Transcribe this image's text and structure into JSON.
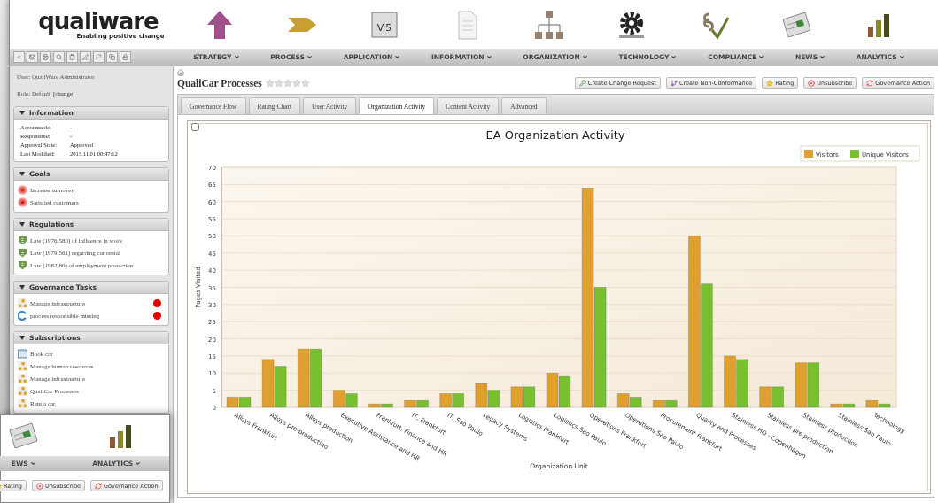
{
  "logo": {
    "name": "qualiware",
    "tagline": "Enabling positive change"
  },
  "nav": [
    {
      "label": "STRATEGY",
      "kind": "up-arrow"
    },
    {
      "label": "PROCESS",
      "kind": "chevron"
    },
    {
      "label": "APPLICATION",
      "kind": "version-box",
      "badge": "V.5"
    },
    {
      "label": "INFORMATION",
      "kind": "document"
    },
    {
      "label": "ORGANIZATION",
      "kind": "org-chart"
    },
    {
      "label": "TECHNOLOGY",
      "kind": "gear"
    },
    {
      "label": "COMPLIANCE",
      "kind": "paragraph"
    },
    {
      "label": "NEWS",
      "kind": "newspaper"
    },
    {
      "label": "ANALYTICS",
      "kind": "bar-chart"
    }
  ],
  "user": {
    "user_line": "User: QualiWare Administrator",
    "role_line": "Role: Default",
    "change_link": "[change]"
  },
  "panels": [
    {
      "title": "Information",
      "expanded": true,
      "kind": "fields",
      "fields": [
        {
          "label": "Accountable:",
          "value": "-"
        },
        {
          "label": "Responsible:",
          "value": "-"
        },
        {
          "label": "Approval State:",
          "value": "Approved"
        },
        {
          "label": "Last Modified:",
          "value": "2013.11.01 00:47:12"
        }
      ]
    },
    {
      "title": "Goals",
      "expanded": true,
      "kind": "items",
      "items": [
        {
          "kind": "target",
          "text": "Increase turnover"
        },
        {
          "kind": "target",
          "text": "Satisfied customers"
        }
      ]
    },
    {
      "title": "Regulations",
      "expanded": true,
      "kind": "items",
      "items": [
        {
          "kind": "shield",
          "text": "Law (1976:580) of influence in work"
        },
        {
          "kind": "shield",
          "text": "Law (1979:561) regarding car rental"
        },
        {
          "kind": "shield",
          "text": "Law (1982:80) of employment protection"
        }
      ]
    },
    {
      "title": "Governance Tasks",
      "expanded": true,
      "kind": "items",
      "items": [
        {
          "kind": "process",
          "text": "Manage infrastructure",
          "color": "#e00000"
        },
        {
          "kind": "cycle",
          "text": "process responsible missing",
          "color": "#e00000"
        }
      ]
    },
    {
      "title": "Subscriptions",
      "expanded": true,
      "kind": "items",
      "items": [
        {
          "kind": "calendar",
          "text": "Book car"
        },
        {
          "kind": "process",
          "text": "Manage human resources"
        },
        {
          "kind": "process",
          "text": "Manage infrastructure"
        },
        {
          "kind": "process",
          "text": "QualiCar Processes"
        },
        {
          "kind": "process",
          "text": "Rent a car"
        }
      ]
    }
  ],
  "page": {
    "title": "QualiCar Processes",
    "stars": 0
  },
  "actions": [
    {
      "label": "Create Change Request",
      "kind": "wrench"
    },
    {
      "label": "Create Non-Conformance",
      "kind": "branch"
    },
    {
      "label": "Rating",
      "kind": "star"
    },
    {
      "label": "Unsubscribe",
      "kind": "unsubscribe"
    },
    {
      "label": "Governance Action",
      "kind": "cycle"
    }
  ],
  "tabs": [
    {
      "label": "Governance Flow",
      "selected": false
    },
    {
      "label": "Rating Chart",
      "selected": false
    },
    {
      "label": "User Activity",
      "selected": false
    },
    {
      "label": "Organization Activity",
      "selected": true
    },
    {
      "label": "Content Activity",
      "selected": false
    },
    {
      "label": "Advanced",
      "selected": false
    }
  ],
  "chart_panel": {
    "checked": false,
    "chart_data": {
      "type": "bar",
      "title": "EA Organization Activity",
      "xlabel": "Organization Unit",
      "ylabel": "Pages Visited",
      "grid": true,
      "legend": true,
      "categories": [
        "Alloys Frankfurt",
        "Alloys pre-productino",
        "Alloys production",
        "Executive Assistance and HR",
        "Frankfurt, Finance and HR",
        "IT, Frankfurt",
        "IT, Sao Paulo",
        "Legacy Systems",
        "Logistics Frankfurt",
        "Logistics Sao Paulo",
        "Operations Frankfurt",
        "Operations Sao Paulo",
        "Procurement Frankfurt",
        "Quality and Processes",
        "Stainless HQ - Copenhagen",
        "Stainless pre production",
        "Stainless production",
        "Stainless Sao Paulo",
        "Technology"
      ],
      "series": [
        {
          "name": "Visitors",
          "color": "#e0a030",
          "values": [
            3,
            14,
            17,
            5,
            1,
            2,
            4,
            7,
            6,
            10,
            64,
            4,
            2,
            50,
            15,
            6,
            13,
            1,
            2
          ]
        },
        {
          "name": "Unique Visitors",
          "color": "#78c030",
          "values": [
            3,
            12,
            17,
            4,
            1,
            2,
            4,
            5,
            6,
            9,
            35,
            3,
            2,
            36,
            14,
            6,
            13,
            1,
            1
          ]
        }
      ],
      "ylim": [
        0,
        70
      ],
      "yticks": [
        0,
        5,
        10,
        15,
        20,
        25,
        30,
        35,
        40,
        45,
        50,
        55,
        60,
        65,
        70
      ]
    }
  },
  "back_window": {
    "nav": [
      {
        "label": "EWS",
        "kind": "newspaper"
      },
      {
        "label": "ANALYTICS",
        "kind": "bar-chart"
      }
    ],
    "actions": [
      {
        "label": "Rating",
        "kind": "star"
      },
      {
        "label": "Unsubscribe",
        "kind": "unsubscribe"
      },
      {
        "label": "Governance Action",
        "kind": "cycle"
      }
    ]
  }
}
